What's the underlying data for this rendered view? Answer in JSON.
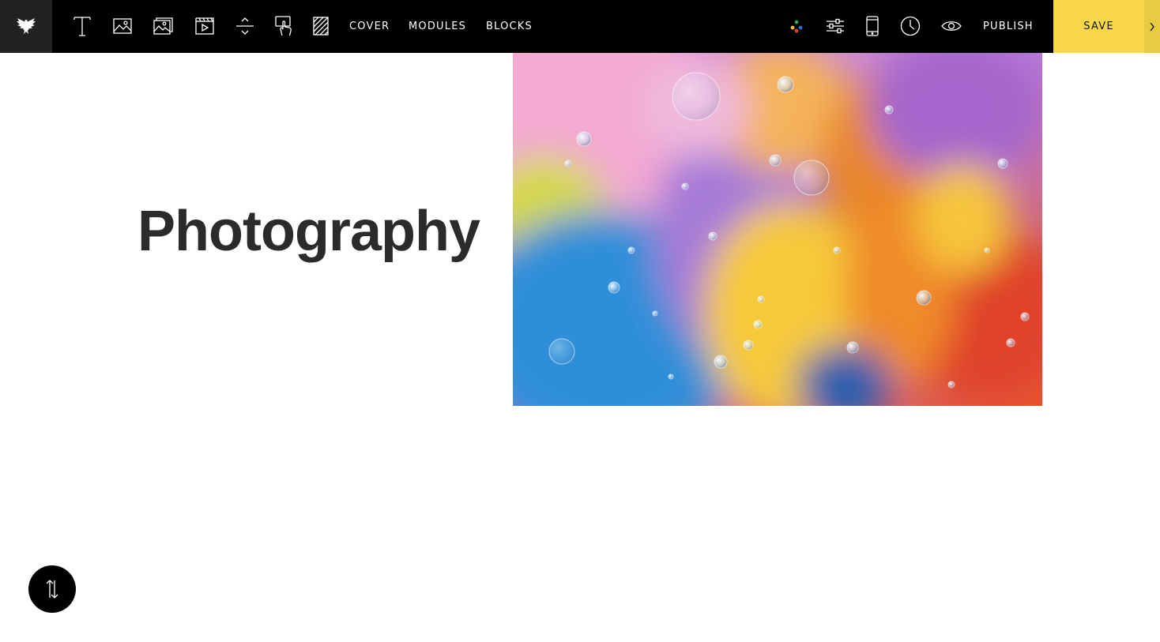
{
  "toolbar": {
    "logo_icon": "eagle-logo-icon",
    "tools": [
      {
        "name": "text-tool",
        "icon": "text-icon"
      },
      {
        "name": "image-tool",
        "icon": "image-icon"
      },
      {
        "name": "image-grid-tool",
        "icon": "image-grid-icon"
      },
      {
        "name": "video-tool",
        "icon": "video-icon"
      },
      {
        "name": "divider-tool",
        "icon": "spacing-icon"
      },
      {
        "name": "interaction-tool",
        "icon": "hand-pointer-icon"
      },
      {
        "name": "background-tool",
        "icon": "hatch-pattern-icon"
      }
    ],
    "cover_label": "COVER",
    "modules_label": "MODULES",
    "blocks_label": "BLOCKS",
    "right_icons": [
      "palette-icon",
      "sliders-icon",
      "mobile-icon",
      "clock-icon",
      "eye-icon"
    ],
    "publish_label": "PUBLISH",
    "save_label": "SAVE",
    "save_color": "#f8d849"
  },
  "content": {
    "heading": "Photography"
  },
  "colors": {
    "toolbar_bg": "#000000",
    "heading": "#2b2b2d"
  }
}
